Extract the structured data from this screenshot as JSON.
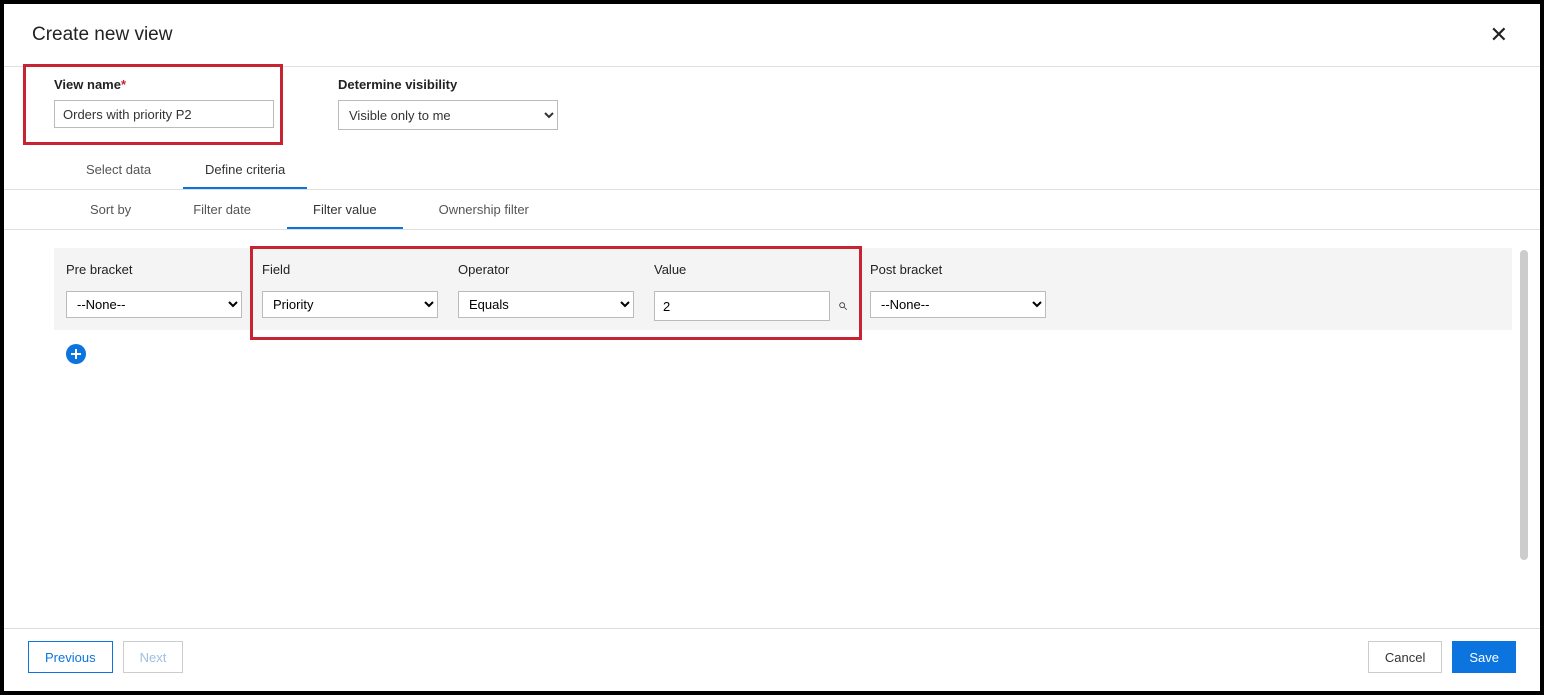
{
  "dialog": {
    "title": "Create new view"
  },
  "fields": {
    "viewNameLabel": "View name",
    "viewNameValue": "Orders with priority P2",
    "visibilityLabel": "Determine visibility",
    "visibilityValue": "Visible only to me"
  },
  "tabsPrimary": {
    "selectData": "Select data",
    "defineCriteria": "Define criteria"
  },
  "tabsSecondary": {
    "sortBy": "Sort by",
    "filterDate": "Filter date",
    "filterValue": "Filter value",
    "ownershipFilter": "Ownership filter"
  },
  "criteria": {
    "headers": {
      "preBracket": "Pre bracket",
      "field": "Field",
      "operator": "Operator",
      "value": "Value",
      "postBracket": "Post bracket"
    },
    "row": {
      "preBracket": "--None--",
      "field": "Priority",
      "operator": "Equals",
      "value": "2",
      "postBracket": "--None--"
    }
  },
  "footer": {
    "previous": "Previous",
    "next": "Next",
    "cancel": "Cancel",
    "save": "Save"
  }
}
